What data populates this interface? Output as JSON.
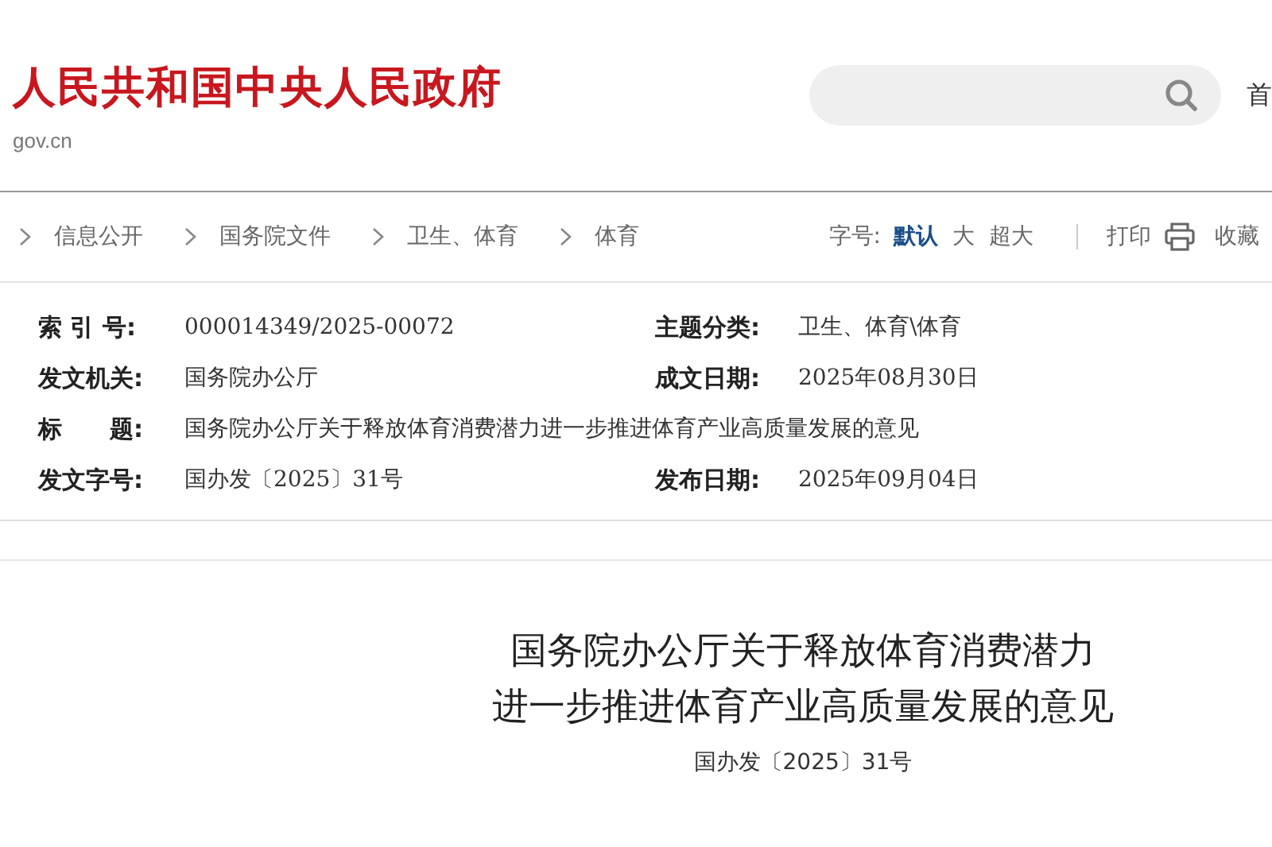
{
  "header": {
    "logo_title": "人民共和国中央人民政府",
    "logo_domain": "gov.cn",
    "nav_link": "首"
  },
  "breadcrumb": [
    "信息公开",
    "国务院文件",
    "卫生、体育",
    "体育"
  ],
  "toolbar": {
    "font_label": "字号:",
    "font_sizes": [
      {
        "label": "默认",
        "selected": true
      },
      {
        "label": "大",
        "selected": false
      },
      {
        "label": "超大",
        "selected": false
      }
    ],
    "print": "打印",
    "favorite": "收藏"
  },
  "meta": [
    {
      "left_label": "索 引 号:",
      "left_value": "000014349/2025-00072",
      "right_label": "主题分类:",
      "right_value": "卫生、体育\\体育"
    },
    {
      "left_label": "发文机关:",
      "left_value": "国务院办公厅",
      "right_label": "成文日期:",
      "right_value": "2025年08月30日"
    },
    {
      "left_label": "标　　题:",
      "left_value": "国务院办公厅关于释放体育消费潜力进一步推进体育产业高质量发展的意见"
    },
    {
      "left_label": "发文字号:",
      "left_value": "国办发〔2025〕31号",
      "right_label": "发布日期:",
      "right_value": "2025年09月04日"
    }
  ],
  "document": {
    "title_lines": [
      "国务院办公厅关于释放体育消费潜力",
      "进一步推进体育产业高质量发展的意见"
    ],
    "doc_number": "国办发〔2025〕31号"
  }
}
